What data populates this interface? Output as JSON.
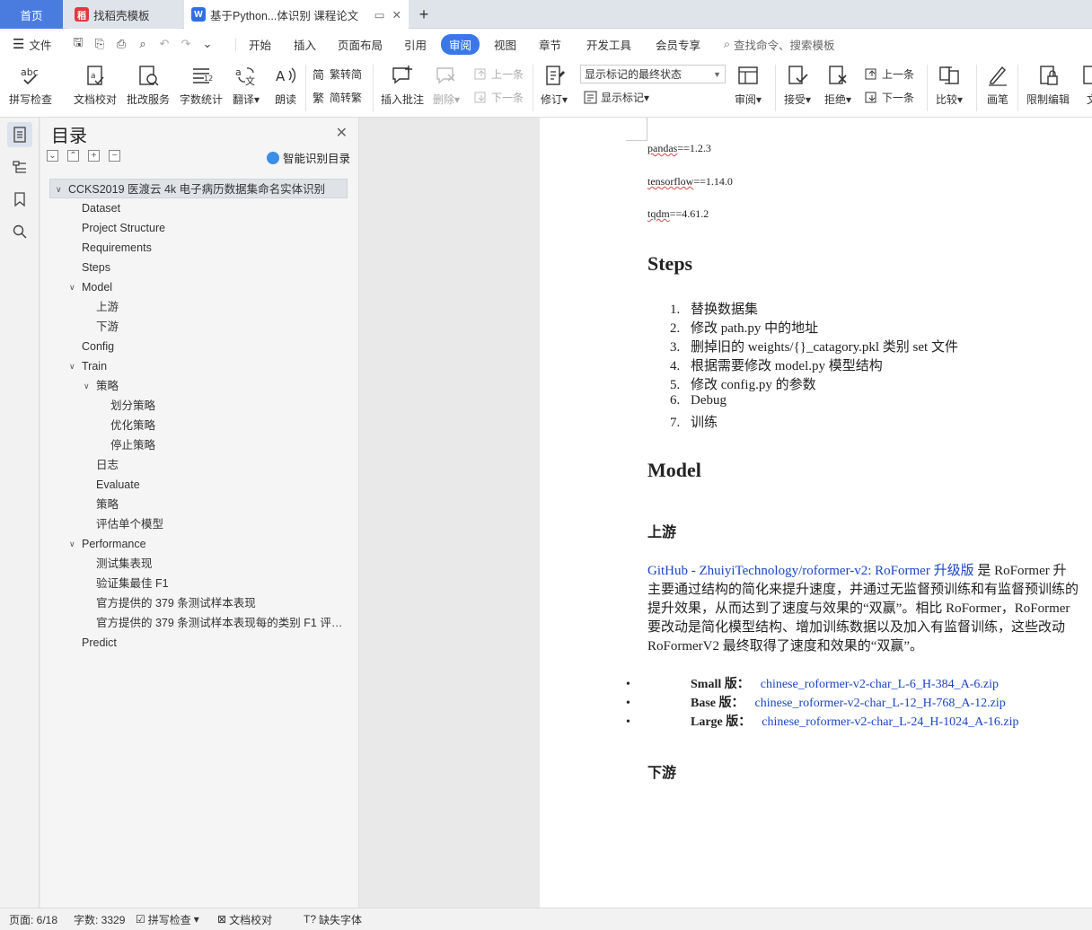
{
  "tabs": [
    {
      "label": "首页"
    },
    {
      "label": "找稻壳模板"
    },
    {
      "label": "基于Python...体识别 课程论文"
    }
  ],
  "menu": {
    "file": "文件",
    "items": [
      "开始",
      "插入",
      "页面布局",
      "引用",
      "审阅",
      "视图",
      "章节",
      "开发工具",
      "会员专享"
    ],
    "active": "审阅",
    "search": "查找命令、搜索模板"
  },
  "ribbon": {
    "spell": "拼写检查",
    "doc_check": "文档校对",
    "review_service": "批改服务",
    "word_count": "字数统计",
    "translate": "翻译",
    "read_aloud": "朗读",
    "trad_to_simp": "繁转简",
    "simp_to_trad": "简转繁",
    "insert_comment": "插入批注",
    "delete": "删除",
    "prev": "上一条",
    "next": "下一条",
    "revise": "修订",
    "markup_state": "显示标记的最终状态",
    "show_markup": "显示标记",
    "review_pane": "审阅",
    "accept": "接受",
    "reject": "拒绝",
    "prev2": "上一条",
    "next2": "下一条",
    "compare": "比较",
    "pen": "画笔",
    "restrict_edit": "限制编辑",
    "doc_more": "文"
  },
  "toc": {
    "title": "目录",
    "smart": "智能识别目录",
    "items": [
      {
        "label": "CCKS2019 医渡云 4k 电子病历数据集命名实体识别",
        "level": 0,
        "toggle": "down",
        "selected": true
      },
      {
        "label": "Dataset",
        "level": 1
      },
      {
        "label": "Project Structure",
        "level": 1
      },
      {
        "label": "Requirements",
        "level": 1
      },
      {
        "label": "Steps",
        "level": 1
      },
      {
        "label": "Model",
        "level": 1,
        "toggle": "down"
      },
      {
        "label": "上游",
        "level": 2
      },
      {
        "label": "下游",
        "level": 2
      },
      {
        "label": "Config",
        "level": 1
      },
      {
        "label": "Train",
        "level": 1,
        "toggle": "down"
      },
      {
        "label": "策略",
        "level": 2,
        "toggle": "down"
      },
      {
        "label": "划分策略",
        "level": 3
      },
      {
        "label": "优化策略",
        "level": 3
      },
      {
        "label": "停止策略",
        "level": 3
      },
      {
        "label": "日志",
        "level": 2
      },
      {
        "label": "Evaluate",
        "level": 2
      },
      {
        "label": "策略",
        "level": 2
      },
      {
        "label": "评估单个模型",
        "level": 2
      },
      {
        "label": "Performance",
        "level": 1,
        "toggle": "down"
      },
      {
        "label": "测试集表现",
        "level": 2
      },
      {
        "label": "验证集最佳 F1",
        "level": 2
      },
      {
        "label": "官方提供的 379 条测试样本表现",
        "level": 2
      },
      {
        "label": "官方提供的 379 条测试样本表现每的类别 F1 评…",
        "level": 2
      },
      {
        "label": "Predict",
        "level": 1
      }
    ]
  },
  "doc": {
    "req1_pkg": "pandas",
    "req1_ver": "==1.2.3",
    "req2_pkg": "tensorflow",
    "req2_ver": "==1.14.0",
    "req3_pkg": "tqdm",
    "req3_ver": "==4.61.2",
    "steps_heading": "Steps",
    "steps": [
      {
        "n": "1.",
        "text": "替换数据集"
      },
      {
        "n": "2.",
        "text": "修改 path.py 中的地址"
      },
      {
        "n": "3.",
        "text": "删掉旧的 weights/{}_catagory.pkl 类别 set 文件"
      },
      {
        "n": "4.",
        "text": "根据需要修改 model.py 模型结构"
      },
      {
        "n": "5.",
        "text": "修改 config.py 的参数"
      },
      {
        "n": "6.",
        "text": "Debug"
      },
      {
        "n": "7.",
        "text": "训练"
      }
    ],
    "model_heading": "Model",
    "upstream_heading": "上游",
    "para_link": "GitHub - ZhuiyiTechnology/roformer-v2: RoFormer 升级版",
    "para_line1_rest": " 是 RoFormer 升",
    "para_line2": "主要通过结构的简化来提升速度，并通过无监督预训练和有监督预训练的",
    "para_line3": "提升效果，从而达到了速度与效果的“双赢”。相比 RoFormer，RoFormer",
    "para_line4": "要改动是简化模型结构、增加训练数据以及加入有监督训练，这些改动",
    "para_line5": "RoFormerV2 最终取得了速度和效果的“双赢”。",
    "versions": [
      {
        "name": "Small 版",
        "sep": "：",
        "link": "chinese_roformer-v2-char_L-6_H-384_A-6.zip"
      },
      {
        "name": "Base 版",
        "sep": "：",
        "link": "chinese_roformer-v2-char_L-12_H-768_A-12.zip"
      },
      {
        "name": "Large 版",
        "sep": "：",
        "link": "chinese_roformer-v2-char_L-24_H-1024_A-16.zip"
      }
    ],
    "downstream_heading": "下游"
  },
  "status": {
    "page": "页面: 6/18",
    "words": "字数: 3329",
    "spell": "拼写检查",
    "doc_check": "文档校对",
    "missing_font": "缺失字体"
  },
  "colors": {
    "accent": "#3a78ea",
    "home_tab": "#4a7ce0",
    "link": "#1a45c5"
  }
}
